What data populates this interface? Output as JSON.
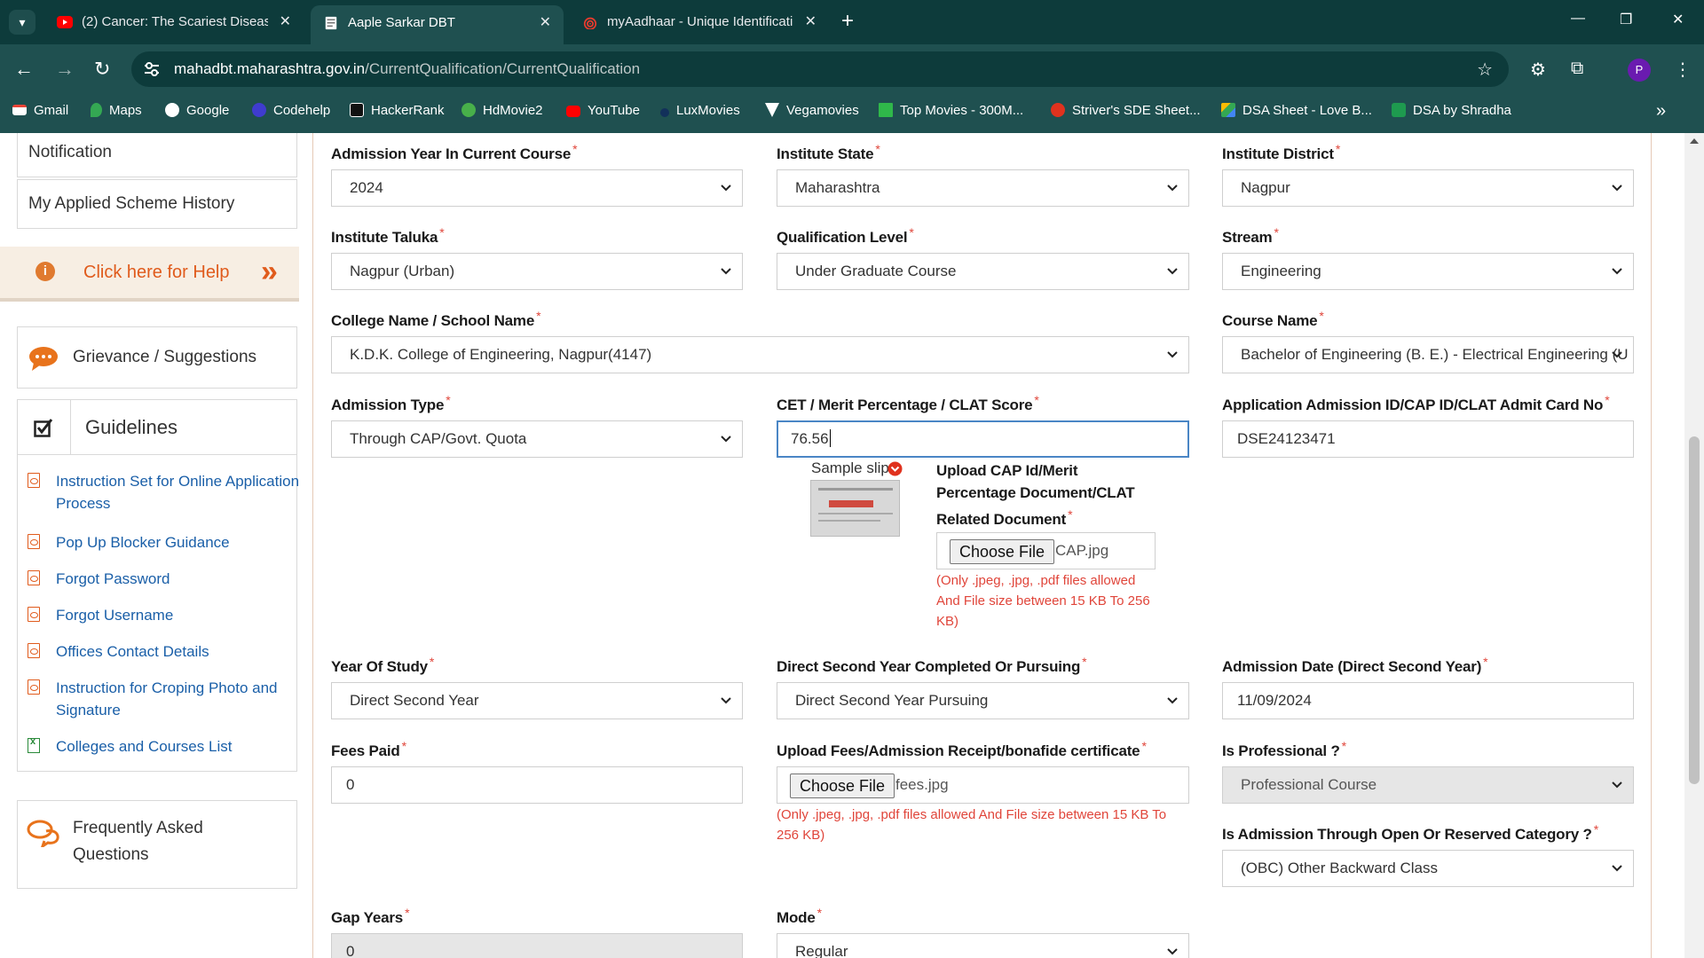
{
  "browser": {
    "tabs": [
      {
        "title": "(2) Cancer: The Scariest Disease",
        "icon": "youtube-icon"
      },
      {
        "title": "Aaple Sarkar DBT",
        "icon": "document-icon"
      },
      {
        "title": "myAadhaar - Unique Identificati",
        "icon": "aadhaar-icon"
      }
    ],
    "url_host": "mahadbt.maharashtra.gov.in",
    "url_path": "/CurrentQualification/CurrentQualification",
    "profile_initial": "P",
    "bookmarks": [
      "Gmail",
      "Maps",
      "Google",
      "Codehelp",
      "HackerRank",
      "HdMovie2",
      "YouTube",
      "LuxMovies",
      "Vegamovies",
      "Top Movies - 300M...",
      "Striver's SDE Sheet...",
      "DSA Sheet - Love B...",
      "DSA by Shradha"
    ]
  },
  "sidebar": {
    "notification": "Notification",
    "applied_history": "My Applied Scheme History",
    "help": "Click here for Help",
    "grievance": "Grievance / Suggestions",
    "guidelines": "Guidelines",
    "guideline_links": [
      "Instruction Set for Online Application Process",
      "Pop Up Blocker Guidance",
      "Forgot Password",
      "Forgot Username",
      "Offices Contact Details",
      "Instruction for Croping Photo and Signature",
      "Colleges and Courses List"
    ],
    "faq": "Frequently Asked Questions"
  },
  "form": {
    "admission_year": {
      "label": "Admission Year In Current Course",
      "value": "2024"
    },
    "institute_state": {
      "label": "Institute State",
      "value": "Maharashtra"
    },
    "institute_district": {
      "label": "Institute District",
      "value": "Nagpur"
    },
    "institute_taluka": {
      "label": "Institute Taluka",
      "value": "Nagpur (Urban)"
    },
    "qualification_level": {
      "label": "Qualification Level",
      "value": "Under Graduate Course"
    },
    "stream": {
      "label": "Stream",
      "value": "Engineering"
    },
    "college_name": {
      "label": "College Name / School Name",
      "value": "K.D.K. College of Engineering, Nagpur(4147)"
    },
    "course_name": {
      "label": "Course Name",
      "value": "Bachelor of Engineering (B. E.) - Electrical Engineering (U"
    },
    "admission_type": {
      "label": "Admission Type",
      "value": "Through CAP/Govt. Quota"
    },
    "cet_score": {
      "label": "CET / Merit Percentage / CLAT Score",
      "value": "76.56"
    },
    "application_id": {
      "label": "Application Admission ID/CAP ID/CLAT Admit Card No",
      "value": "DSE24123471"
    },
    "sample_slip": "Sample slip",
    "upload_cap": {
      "label": "Upload CAP Id/Merit Percentage Document/CLAT Related Document",
      "button": "Choose File",
      "file": "CAP.jpg",
      "hint": "(Only .jpeg, .jpg, .pdf files allowed And File size between 15 KB To 256 KB)"
    },
    "year_of_study": {
      "label": "Year Of Study",
      "value": "Direct Second Year"
    },
    "dsy_status": {
      "label": "Direct Second Year Completed Or Pursuing",
      "value": "Direct Second Year Pursuing"
    },
    "admission_date": {
      "label": "Admission Date (Direct Second Year)",
      "value": "11/09/2024"
    },
    "fees_paid": {
      "label": "Fees Paid",
      "value": "0"
    },
    "upload_fees": {
      "label": "Upload Fees/Admission Receipt/bonafide certificate",
      "button": "Choose File",
      "file": "fees.jpg",
      "hint": "(Only .jpeg, .jpg, .pdf files allowed And File size between 15 KB To 256 KB)"
    },
    "is_professional": {
      "label": "Is Professional ?",
      "value": "Professional Course"
    },
    "category": {
      "label": "Is Admission Through Open Or Reserved Category ?",
      "value": "(OBC) Other Backward Class"
    },
    "gap_years": {
      "label": "Gap Years",
      "value": "0"
    },
    "mode": {
      "label": "Mode",
      "value": "Regular"
    }
  }
}
